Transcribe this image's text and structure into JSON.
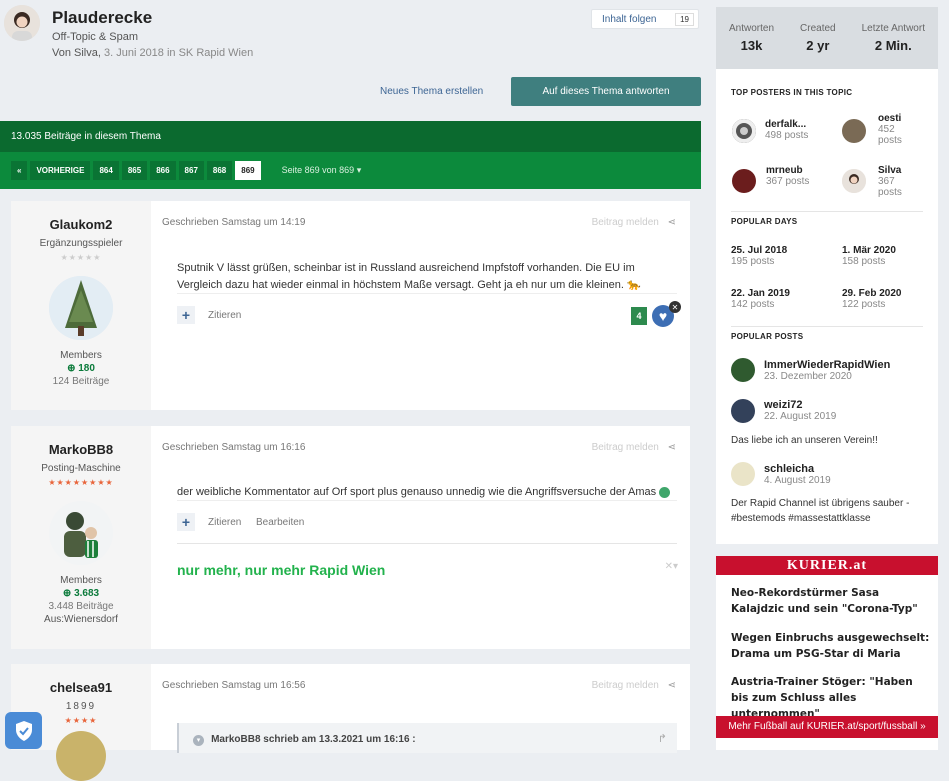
{
  "header": {
    "title": "Plauderecke",
    "subtitle": "Off-Topic & Spam",
    "by_prefix": "Von Silva, ",
    "date": "3. Juni 2018",
    "in_forum": " in SK Rapid Wien",
    "follow_label": "Inhalt folgen",
    "follow_count": "19"
  },
  "actions": {
    "new_topic": "Neues Thema erstellen",
    "reply": "Auf dieses Thema antworten"
  },
  "postcount": "13.035 Beiträge in diesem Thema",
  "pagination": {
    "first": "«",
    "prev": "VORHERIGE",
    "pages": [
      "864",
      "865",
      "866",
      "867",
      "868",
      "869"
    ],
    "active": "869",
    "info": "Seite 869 von 869"
  },
  "posts": [
    {
      "author": "Glaukom2",
      "rank": "Ergänzungsspieler",
      "stars": "★★★★★",
      "group": "Members",
      "reputation": "180",
      "count": "124 Beiträge",
      "meta": "Geschrieben Samstag um 14:19",
      "tools": "Beitrag melden",
      "text": "Sputnik V lässt grüßen, scheinbar ist in Russland ausreichend Impfstoff vorhanden. Die EU im Vergleich dazu hat wieder einmal in höchstem Maße versagt. Geht ja eh nur um die kleinen.",
      "quote_label": "Zitieren",
      "likes": "4"
    },
    {
      "author": "MarkoBB8",
      "rank": "Posting-Maschine",
      "stars": "★★★★★★★★",
      "group": "Members",
      "reputation": "3.683",
      "count": "3.448 Beiträge",
      "location": "Aus:Wienersdorf",
      "meta": "Geschrieben Samstag um 16:16",
      "tools": "Beitrag melden",
      "text": "der weibliche Kommentator auf Orf sport plus genauso unnedig wie die Angriffsversuche der Amas",
      "quote_label": "Zitieren",
      "edit_label": "Bearbeiten",
      "signature": "nur mehr, nur mehr Rapid Wien"
    },
    {
      "author": "chelsea91",
      "rank": "1899",
      "stars": "★★★★",
      "meta": "Geschrieben Samstag um 16:56",
      "tools": "Beitrag melden",
      "quote_header": "MarkoBB8 schrieb am 13.3.2021 um 16:16 :"
    }
  ],
  "sidebar": {
    "stats": [
      {
        "label": "Antworten",
        "value": "13k"
      },
      {
        "label": "Created",
        "value": "2 yr"
      },
      {
        "label": "Letzte Antwort",
        "value": "2 Min."
      }
    ],
    "top_posters_title": "TOP POSTERS IN THIS TOPIC",
    "top_posters": [
      {
        "name": "derfalk...",
        "posts": "498 posts"
      },
      {
        "name": "oesti",
        "posts": "452 posts"
      },
      {
        "name": "mrneub",
        "posts": "367 posts"
      },
      {
        "name": "Silva",
        "posts": "367 posts"
      }
    ],
    "popular_days_title": "POPULAR DAYS",
    "popular_days": [
      {
        "date": "25. Jul 2018",
        "posts": "195 posts"
      },
      {
        "date": "1. Mär 2020",
        "posts": "158 posts"
      },
      {
        "date": "22. Jan 2019",
        "posts": "142 posts"
      },
      {
        "date": "29. Feb 2020",
        "posts": "122 posts"
      }
    ],
    "popular_posts_title": "POPULAR POSTS",
    "popular_posts": [
      {
        "name": "ImmerWiederRapidWien",
        "date": "23. Dezember 2020",
        "text": ""
      },
      {
        "name": "weizi72",
        "date": "22. August 2019",
        "text": "Das liebe ich an unseren Verein!!"
      },
      {
        "name": "schleicha",
        "date": "4. August 2019",
        "text": "Der Rapid Channel ist übrigens sauber - #bestemods #massestattklasse"
      }
    ]
  },
  "kurier": {
    "logo": "KURIER.at",
    "items": [
      "Neo-Rekordstürmer Sasa Kalajdzic und sein \"Corona-Typ\"",
      "Wegen Einbruchs ausgewechselt: Drama um PSG-Star di Maria",
      "Austria-Trainer Stöger: \"Haben bis zum Schluss alles unternommen\""
    ],
    "more": "Mehr Fußball auf KURIER.at/sport/fussball »"
  },
  "colors": {
    "green_dark": "#0b6a2f",
    "green": "#0c8a3c",
    "teal_button": "#3f7f7f",
    "link": "#3d6594",
    "kurier_red": "#c8102e"
  }
}
